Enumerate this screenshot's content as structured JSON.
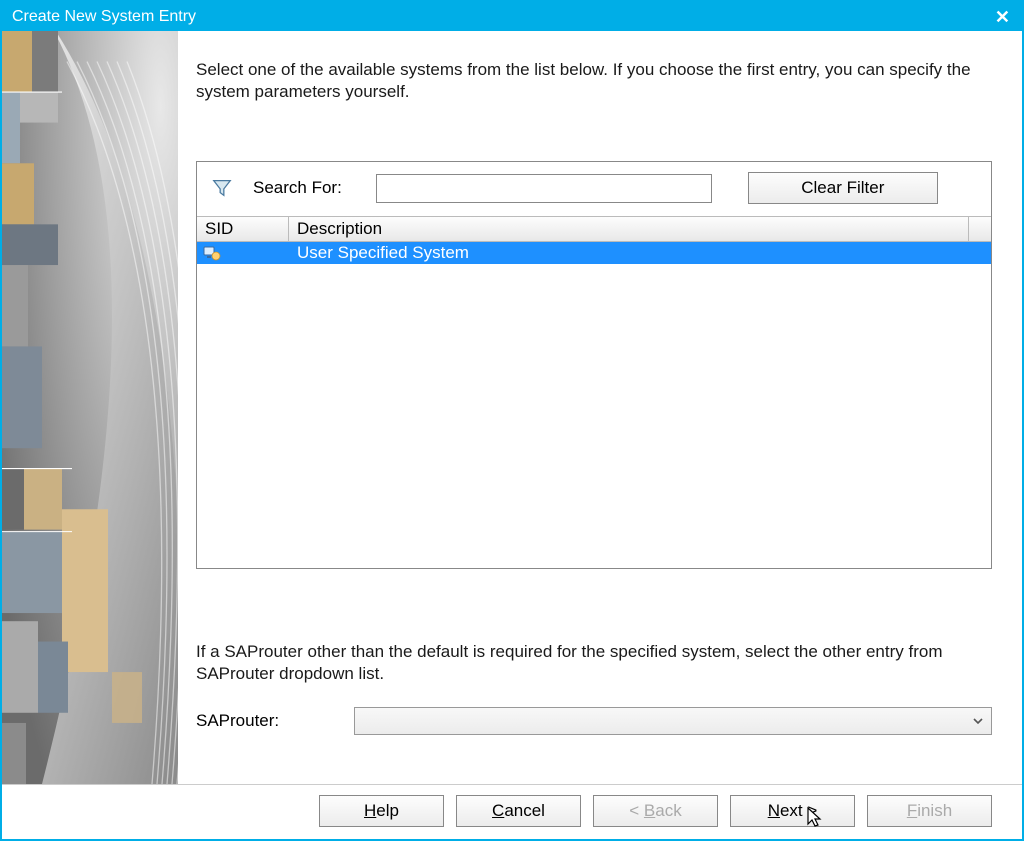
{
  "window": {
    "title": "Create New System Entry"
  },
  "instruction": "Select one of the available systems from the list below. If you choose the first entry, you can specify the system parameters yourself.",
  "filter": {
    "search_label": "Search For:",
    "search_value": "",
    "clear_label": "Clear Filter"
  },
  "table": {
    "columns": {
      "sid": "SID",
      "description": "Description"
    },
    "rows": [
      {
        "sid": "",
        "description": "User Specified System",
        "selected": true
      }
    ]
  },
  "note": "If a SAProuter other than the default is required for the specified system, select the other entry from SAProuter dropdown list.",
  "router": {
    "label": "SAProuter:",
    "value": ""
  },
  "buttons": {
    "help": "Help",
    "cancel": "Cancel",
    "back": "< Back",
    "next": "Next >",
    "finish": "Finish"
  }
}
